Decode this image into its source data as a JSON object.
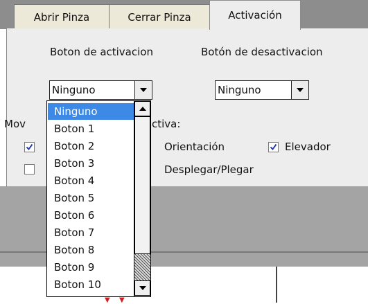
{
  "tabs": [
    {
      "label": "Abrir Pinza",
      "active": false
    },
    {
      "label": "Cerrar Pinza",
      "active": false
    },
    {
      "label": "Activación",
      "active": true
    }
  ],
  "activation": {
    "activation_button_label": "Boton de activacion",
    "deactivation_button_label": "Botón de desactivacion",
    "activation_combo_value": "Ninguno",
    "deactivation_combo_value": "Ninguno"
  },
  "movement": {
    "label_left": "Mov",
    "label_right": "ctiva:",
    "checkboxes": [
      {
        "label": "Orientación",
        "checked": false
      },
      {
        "label": "Elevador",
        "checked": true
      },
      {
        "label": "Desplegar/Plegar",
        "checked": false
      }
    ],
    "hidden_left_checks": [
      true,
      false
    ]
  },
  "dropdown": {
    "options": [
      "Ninguno",
      "Boton 1",
      "Boton 2",
      "Boton 3",
      "Boton 4",
      "Boton 5",
      "Boton 6",
      "Boton 7",
      "Boton 8",
      "Boton 9",
      "Boton 10"
    ],
    "selected": "Ninguno"
  },
  "colors": {
    "selection": "#3d8ae6",
    "panel": "#ededed",
    "tab_strip": "#8d8d8d",
    "check": "#2c3fb0"
  }
}
